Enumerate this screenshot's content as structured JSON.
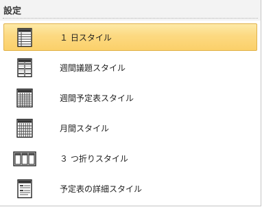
{
  "header": {
    "title": "設定"
  },
  "styles": [
    {
      "label": "１ 日スタイル",
      "icon": "daily-style-icon",
      "selected": true
    },
    {
      "label": "週間議題スタイル",
      "icon": "weekly-agenda-style-icon",
      "selected": false
    },
    {
      "label": "週間予定表スタイル",
      "icon": "weekly-calendar-style-icon",
      "selected": false
    },
    {
      "label": "月間スタイル",
      "icon": "monthly-style-icon",
      "selected": false
    },
    {
      "label": "３ つ折りスタイル",
      "icon": "tri-fold-style-icon",
      "selected": false
    },
    {
      "label": "予定表の詳細スタイル",
      "icon": "calendar-details-style-icon",
      "selected": false
    }
  ]
}
